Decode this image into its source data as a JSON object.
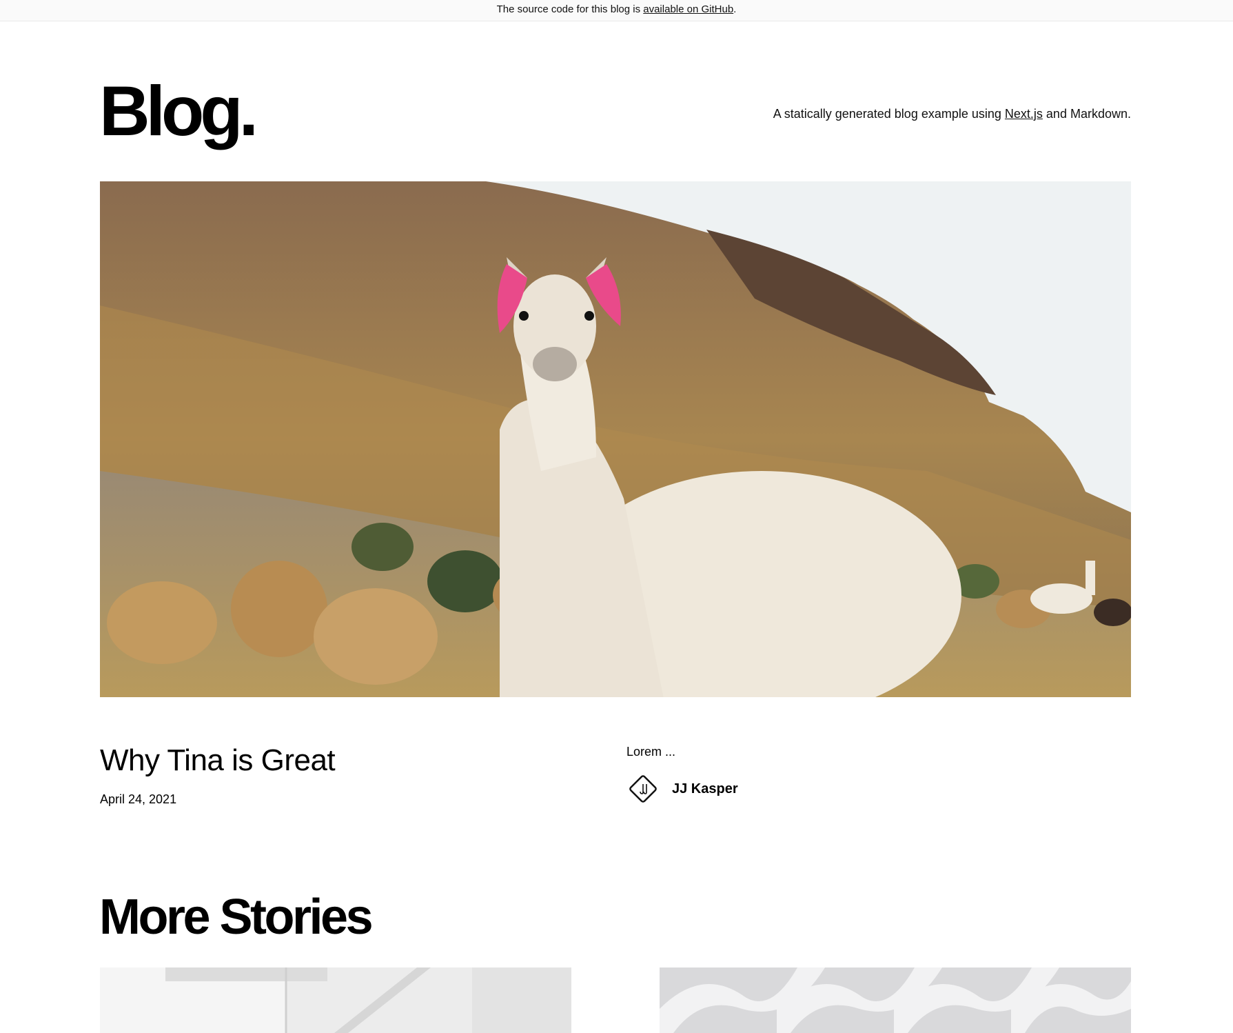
{
  "banner": {
    "text_before": "The source code for this blog is ",
    "link_text": "available on GitHub",
    "text_after": "."
  },
  "header": {
    "brand": "Blog.",
    "tagline_before": "A statically generated blog example using ",
    "tagline_link": "Next.js",
    "tagline_after": " and Markdown."
  },
  "hero_post": {
    "image_alt": "llama-hero-image",
    "title": "Why Tina is Great",
    "date": "April 24, 2021",
    "excerpt": "Lorem ...",
    "author": {
      "name": "JJ Kasper",
      "avatar_icon": "jj-monogram-diamond-icon"
    }
  },
  "more_stories": {
    "heading": "More Stories",
    "cards": [
      {
        "image_alt": "white-architecture-image"
      },
      {
        "image_alt": "white-twisted-structure-image"
      }
    ]
  }
}
